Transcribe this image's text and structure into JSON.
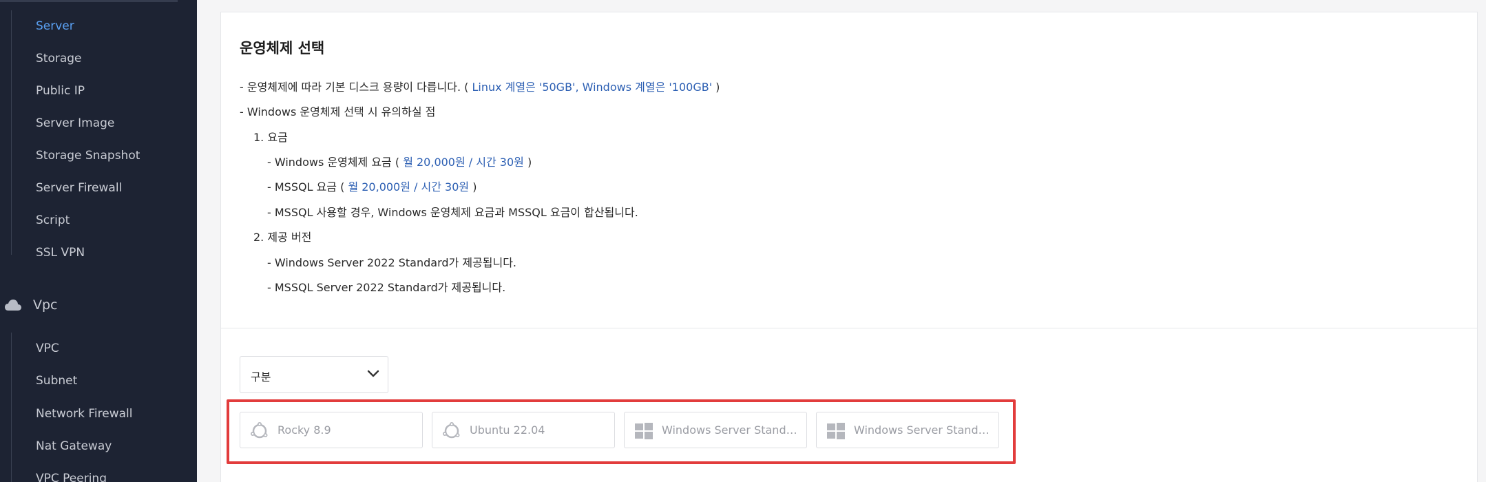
{
  "sidebar": {
    "compute_items": [
      {
        "label": "Server",
        "active": true
      },
      {
        "label": "Storage"
      },
      {
        "label": "Public IP"
      },
      {
        "label": "Server Image"
      },
      {
        "label": "Storage Snapshot"
      },
      {
        "label": "Server Firewall"
      },
      {
        "label": "Script"
      },
      {
        "label": "SSL VPN"
      }
    ],
    "vpc_section": {
      "label": "Vpc",
      "icon": "cloud-icon"
    },
    "vpc_items": [
      {
        "label": "VPC"
      },
      {
        "label": "Subnet"
      },
      {
        "label": "Network Firewall"
      },
      {
        "label": "Nat Gateway"
      },
      {
        "label": "VPC Peering"
      }
    ]
  },
  "os_section": {
    "title": "운영체제 선택",
    "disk_note": {
      "prefix": "- 운영체제에 따라 기본 디스크 용량이 다릅니다. ( ",
      "highlight": "Linux 계열은 '50GB', Windows 계열은 '100GB'",
      "suffix": " )"
    },
    "windows_note": "- Windows 운영체제 선택 시 유의하실 점",
    "fee_heading": "1. 요금",
    "fee_windows": {
      "prefix": "- Windows 운영체제 요금 ( ",
      "highlight": "월 20,000원 / 시간 30원",
      "suffix": " )"
    },
    "fee_mssql": {
      "prefix": "- MSSQL 요금 ( ",
      "highlight": "월 20,000원 / 시간 30원",
      "suffix": " )"
    },
    "fee_combined": "- MSSQL 사용할 경우, Windows 운영체제 요금과 MSSQL 요금이 합산됩니다.",
    "version_heading": "2. 제공 버전",
    "version_windows": "- Windows Server 2022 Standard가 제공됩니다.",
    "version_mssql": "- MSSQL Server 2022 Standard가 제공됩니다."
  },
  "filter": {
    "selected": "구분",
    "icon": "chevron-down-icon"
  },
  "os_options": [
    {
      "name": "Rocky 8.9",
      "icon": "linux-os-icon"
    },
    {
      "name": "Ubuntu 22.04",
      "icon": "linux-os-icon"
    },
    {
      "name": "Windows Server Stand…",
      "icon": "windows-icon"
    },
    {
      "name": "Windows Server Stand…",
      "icon": "windows-icon"
    }
  ],
  "colors": {
    "accent": "#5aa0f2",
    "highlight_text": "#2c5fb3",
    "selection_border": "#e23c3c",
    "sidebar_bg": "#1d2333"
  }
}
